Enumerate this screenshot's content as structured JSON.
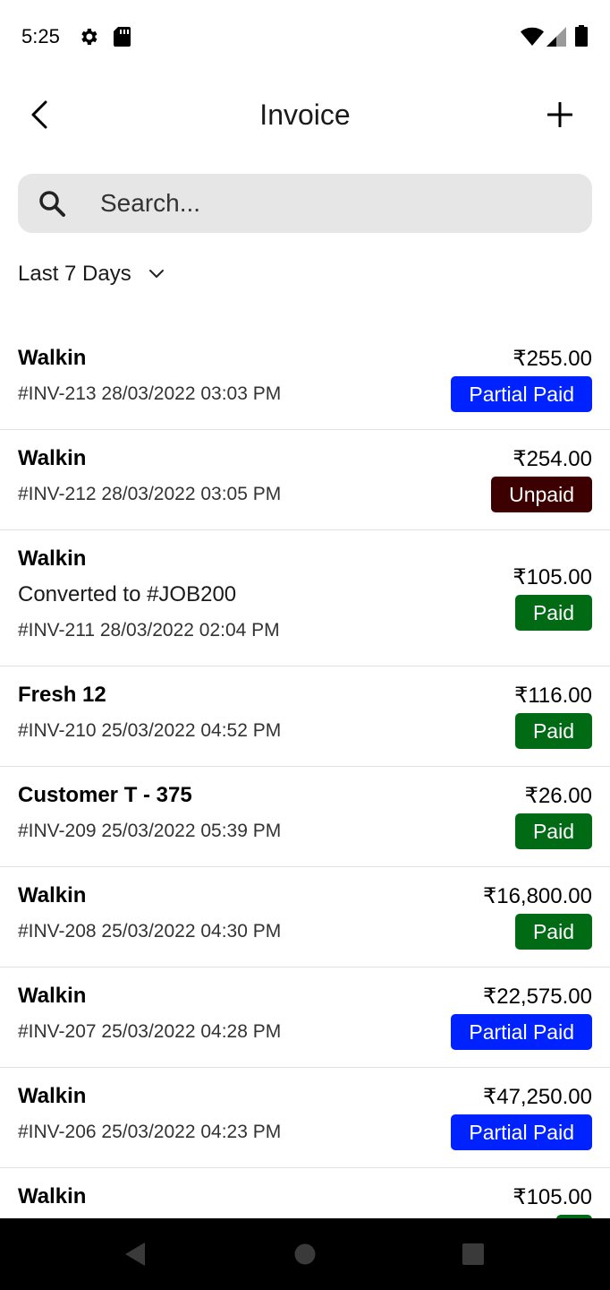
{
  "status_bar": {
    "time": "5:25",
    "icons": [
      "gear-icon",
      "sd-card-icon",
      "wifi-icon",
      "signal-icon",
      "battery-icon"
    ]
  },
  "header": {
    "title": "Invoice",
    "back_icon": "chevron-left-icon",
    "add_icon": "plus-icon"
  },
  "search": {
    "placeholder": "Search...",
    "value": ""
  },
  "filter": {
    "selected": "Last 7 Days"
  },
  "colors": {
    "partial_paid": "#0022ff",
    "unpaid": "#3d0000",
    "paid": "#006b14",
    "search_bg": "#e6e6e6"
  },
  "invoices": [
    {
      "name": "Walkin",
      "note": "",
      "meta": "#INV-213 28/03/2022 03:03 PM",
      "amount": "₹255.00",
      "status": "Partial Paid",
      "status_key": "partial_paid"
    },
    {
      "name": "Walkin",
      "note": "",
      "meta": "#INV-212 28/03/2022 03:05 PM",
      "amount": "₹254.00",
      "status": "Unpaid",
      "status_key": "unpaid"
    },
    {
      "name": "Walkin",
      "note": "Converted to #JOB200",
      "meta": "#INV-211 28/03/2022 02:04 PM",
      "amount": "₹105.00",
      "status": "Paid",
      "status_key": "paid"
    },
    {
      "name": "Fresh 12",
      "note": "",
      "meta": "#INV-210 25/03/2022 04:52 PM",
      "amount": "₹116.00",
      "status": "Paid",
      "status_key": "paid"
    },
    {
      "name": "Customer T - 375",
      "note": "",
      "meta": "#INV-209 25/03/2022 05:39 PM",
      "amount": "₹26.00",
      "status": "Paid",
      "status_key": "paid"
    },
    {
      "name": "Walkin",
      "note": "",
      "meta": "#INV-208 25/03/2022 04:30 PM",
      "amount": "₹16,800.00",
      "status": "Paid",
      "status_key": "paid"
    },
    {
      "name": "Walkin",
      "note": "",
      "meta": "#INV-207 25/03/2022 04:28 PM",
      "amount": "₹22,575.00",
      "status": "Partial Paid",
      "status_key": "partial_paid"
    },
    {
      "name": "Walkin",
      "note": "",
      "meta": "#INV-206 25/03/2022 04:23 PM",
      "amount": "₹47,250.00",
      "status": "Partial Paid",
      "status_key": "partial_paid"
    },
    {
      "name": "Walkin",
      "note": "",
      "meta": "",
      "amount": "₹105.00",
      "status": "",
      "status_key": "paid"
    }
  ],
  "nav_bar": {
    "icons": [
      "nav-back-icon",
      "nav-home-icon",
      "nav-recents-icon"
    ]
  }
}
